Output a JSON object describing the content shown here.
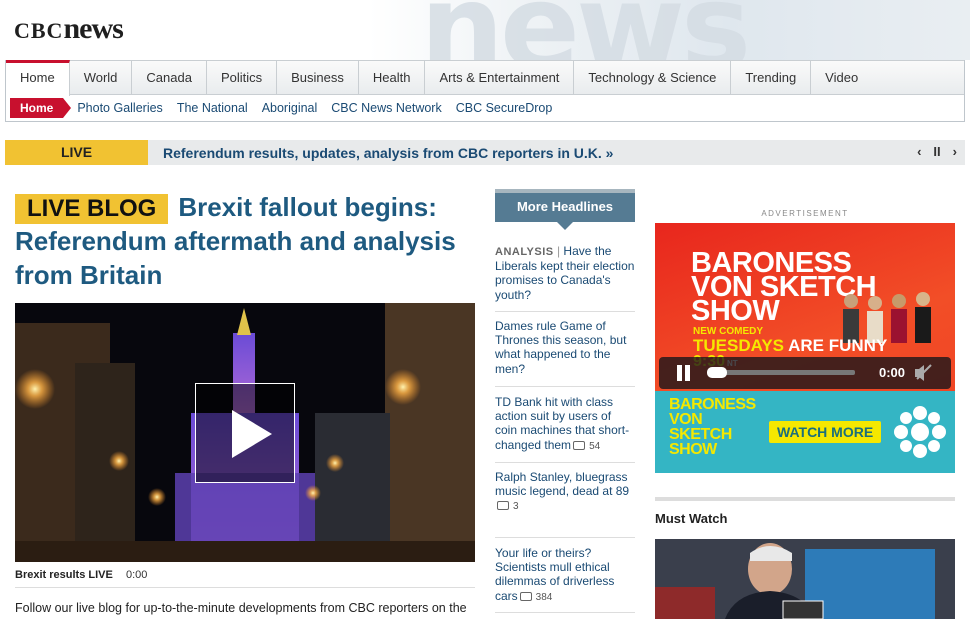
{
  "brand": {
    "logo_cbc": "CBC",
    "logo_news": "news",
    "bg_word": "news"
  },
  "nav": {
    "tabs": [
      "Home",
      "World",
      "Canada",
      "Politics",
      "Business",
      "Health",
      "Arts & Entertainment",
      "Technology & Science",
      "Trending",
      "Video"
    ],
    "active": "Home"
  },
  "subnav": {
    "active": "Home",
    "links": [
      "Photo Galleries",
      "The National",
      "Aboriginal",
      "CBC News Network",
      "CBC SecureDrop"
    ]
  },
  "live": {
    "label": "LIVE",
    "text": "Referendum results, updates, analysis from CBC reporters in U.K. »",
    "prev": "‹",
    "pause": "II",
    "next": "›"
  },
  "main": {
    "badge": "LIVE BLOG",
    "headline": "Brexit fallout begins: Referendum aftermath and analysis from Britain",
    "video_caption": "Brexit results LIVE",
    "video_time": "0:00",
    "teaser": "Follow our live blog for up-to-the-minute developments from CBC reporters on the"
  },
  "more": {
    "title": "More Headlines",
    "items": [
      {
        "prefix": "ANALYSIS",
        "text": "Have the Liberals kept their election promises to Canada's youth?",
        "comments": ""
      },
      {
        "prefix": "",
        "text": "Dames rule Game of Thrones this season, but what happened to the men?",
        "comments": ""
      },
      {
        "prefix": "",
        "text": "TD Bank hit with class action suit by users of coin machines that short-changed them",
        "comments": "54"
      },
      {
        "prefix": "",
        "text": "Ralph Stanley, bluegrass music legend, dead at 89",
        "comments": "3"
      },
      {
        "prefix": "",
        "text": "Your life or theirs? Scientists mull ethical dilemmas of driverless cars",
        "comments": "384"
      }
    ]
  },
  "ad": {
    "label": "ADVERTISEMENT",
    "title": "BARONESS VON SKETCH SHOW",
    "new": "NEW COMEDY",
    "day": "TUESDAYS",
    "are": "ARE FUNNY",
    "time": "9:30",
    "tz": "NT",
    "player_time": "0:00",
    "bottom_title": "BARONESS VON SKETCH SHOW",
    "watch": "WATCH MORE"
  },
  "must_watch": {
    "title": "Must Watch"
  },
  "colors": {
    "accent": "#c8102e",
    "live": "#f1c232",
    "link": "#1a4a73"
  }
}
